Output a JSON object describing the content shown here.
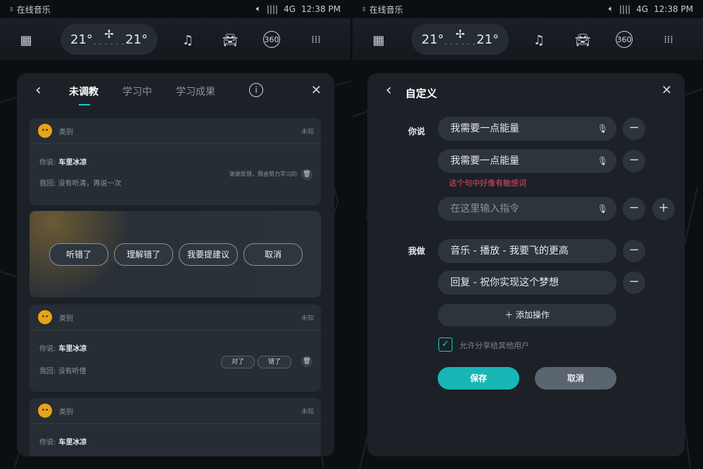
{
  "status": {
    "app_name": "在线音乐",
    "signal": "4G",
    "time": "12:38 PM"
  },
  "topbar": {
    "temp_left": "21°",
    "temp_right": "21°"
  },
  "left_panel": {
    "tabs": [
      "未调教",
      "学习中",
      "学习成果"
    ],
    "card1": {
      "category": "类别",
      "status": "未知",
      "you_said_label": "你说:",
      "you_said": "车里冰凉",
      "i_reply_label": "我回:",
      "i_reply": "没有听清，再说一次",
      "hint": "谢谢反馈，我会努力学习的"
    },
    "feedback_buttons": [
      "听错了",
      "理解错了",
      "我要提建议",
      "取消"
    ],
    "card2": {
      "category": "类别",
      "status": "未知",
      "you_said_label": "你说:",
      "you_said": "车里冰凉",
      "i_reply_label": "我回:",
      "i_reply": "没有听懂",
      "btn_right": "对了",
      "btn_wrong": "错了"
    },
    "card3": {
      "category": "类别",
      "status": "未知",
      "you_said_label": "你说:",
      "you_said": "车里冰凉"
    }
  },
  "right_panel": {
    "title": "自定义",
    "you_say_label": "你说",
    "inputs": [
      {
        "value": "我需要一点能量"
      },
      {
        "value": "我需要一点能量"
      }
    ],
    "warning": "这个句中好像有敏感词",
    "new_input_placeholder": "在这里输入指令",
    "i_do_label": "我做",
    "actions": [
      "音乐 - 播放 - 我要飞的更高",
      "回复 - 祝你实现这个梦想"
    ],
    "add_action": "添加操作",
    "share_label": "允许分享给其他用户",
    "share_checked": true,
    "save": "保存",
    "cancel": "取消"
  },
  "colors": {
    "accent": "#18b7b5",
    "warning": "#e04a6b",
    "avatar": "#e8a318"
  }
}
